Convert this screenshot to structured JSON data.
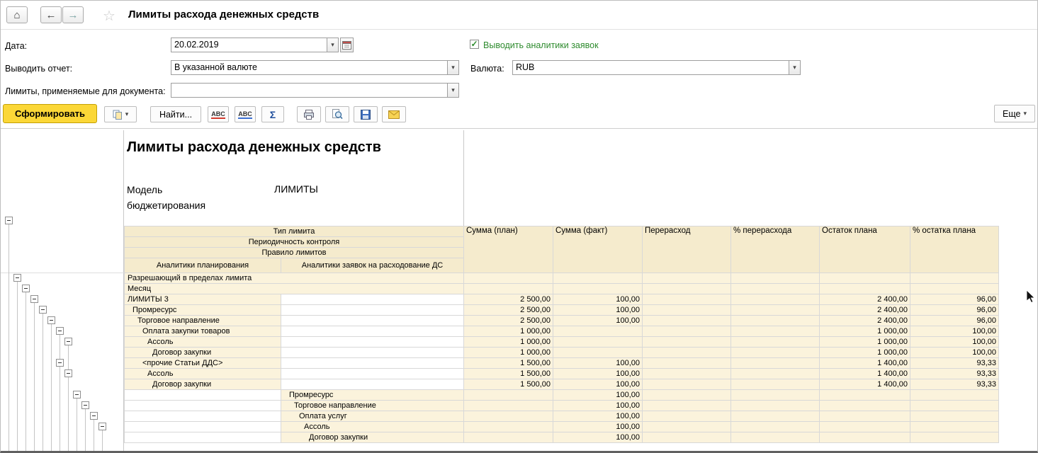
{
  "header": {
    "title": "Лимиты расхода денежных средств"
  },
  "icons": {
    "home": "⌂",
    "back": "←",
    "forward": "→",
    "star": "☆",
    "combo_arrow": "▾",
    "check": "✓",
    "sigma": "Σ",
    "more_arrow": "▾",
    "abc": "ABC"
  },
  "colors": {
    "generate_button": "#fbd737",
    "header_beige": "#f5ebcd",
    "data_beige": "#fbf3dc",
    "checkbox_green": "#2e8b2e"
  },
  "filters": {
    "date_label": "Дата:",
    "date_value": "20.02.2019",
    "analytics_label": "Выводить аналитики заявок",
    "report_mode_label": "Выводить отчет:",
    "report_mode_value": "В указанной валюте",
    "currency_label": "Валюта:",
    "currency_value": "RUB",
    "limits_label": "Лимиты, применяемые для документа:",
    "limits_value": ""
  },
  "commands": {
    "generate": "Сформировать",
    "find": "Найти...",
    "more": "Еще"
  },
  "report": {
    "title": "Лимиты расхода денежных средств",
    "model_label": "Модель бюджетирования",
    "model_value": "ЛИМИТЫ",
    "table": {
      "band_headers": [
        "Тип лимита",
        "Периодичность контроля",
        "Правило лимитов"
      ],
      "plan_col": "Аналитики планирования",
      "req_col": "Аналитики заявок на расходование ДС",
      "value_cols": [
        "Сумма (план)",
        "Сумма (факт)",
        "Перерасход",
        "% перерасхода",
        "Остаток плана",
        "% остатка плана"
      ],
      "rows": [
        {
          "label": "Разрешающий в пределах лимита",
          "side": "span",
          "indent": 0,
          "tree": 1,
          "values": [
            "",
            "",
            "",
            "",
            "",
            ""
          ]
        },
        {
          "label": "Месяц",
          "side": "span",
          "indent": 0,
          "tree": 2,
          "values": [
            "",
            "",
            "",
            "",
            "",
            ""
          ]
        },
        {
          "label": "ЛИМИТЫ 3",
          "side": "plan",
          "indent": 0,
          "tree": 3,
          "values": [
            "2 500,00",
            "100,00",
            "",
            "",
            "2 400,00",
            "96,00"
          ]
        },
        {
          "label": "Промресурс",
          "side": "plan",
          "indent": 1,
          "tree": 4,
          "values": [
            "2 500,00",
            "100,00",
            "",
            "",
            "2 400,00",
            "96,00"
          ]
        },
        {
          "label": "Торговое направление",
          "side": "plan",
          "indent": 2,
          "tree": 5,
          "values": [
            "2 500,00",
            "100,00",
            "",
            "",
            "2 400,00",
            "96,00"
          ]
        },
        {
          "label": "Оплата закупки товаров",
          "side": "plan",
          "indent": 3,
          "tree": 6,
          "values": [
            "1 000,00",
            "",
            "",
            "",
            "1 000,00",
            "100,00"
          ]
        },
        {
          "label": "Ассоль",
          "side": "plan",
          "indent": 4,
          "tree": 7,
          "values": [
            "1 000,00",
            "",
            "",
            "",
            "1 000,00",
            "100,00"
          ]
        },
        {
          "label": "Договор закупки",
          "side": "plan",
          "indent": 5,
          "tree": null,
          "values": [
            "1 000,00",
            "",
            "",
            "",
            "1 000,00",
            "100,00"
          ]
        },
        {
          "label": "<прочие Статьи ДДС>",
          "side": "plan",
          "indent": 3,
          "tree": 6,
          "values": [
            "1 500,00",
            "100,00",
            "",
            "",
            "1 400,00",
            "93,33"
          ]
        },
        {
          "label": "Ассоль",
          "side": "plan",
          "indent": 4,
          "tree": 7,
          "values": [
            "1 500,00",
            "100,00",
            "",
            "",
            "1 400,00",
            "93,33"
          ]
        },
        {
          "label": "Договор закупки",
          "side": "plan",
          "indent": 5,
          "tree": null,
          "values": [
            "1 500,00",
            "100,00",
            "",
            "",
            "1 400,00",
            "93,33"
          ]
        },
        {
          "label": "Промресурс",
          "side": "req",
          "indent": 1,
          "tree": 8,
          "values": [
            "",
            "100,00",
            "",
            "",
            "",
            ""
          ]
        },
        {
          "label": "Торговое направление",
          "side": "req",
          "indent": 2,
          "tree": 9,
          "values": [
            "",
            "100,00",
            "",
            "",
            "",
            ""
          ]
        },
        {
          "label": "Оплата услуг",
          "side": "req",
          "indent": 3,
          "tree": 10,
          "values": [
            "",
            "100,00",
            "",
            "",
            "",
            ""
          ]
        },
        {
          "label": "Ассоль",
          "side": "req",
          "indent": 4,
          "tree": 11,
          "values": [
            "",
            "100,00",
            "",
            "",
            "",
            ""
          ]
        },
        {
          "label": "Договор закупки",
          "side": "req",
          "indent": 5,
          "tree": null,
          "values": [
            "",
            "100,00",
            "",
            "",
            "",
            ""
          ]
        }
      ]
    }
  }
}
